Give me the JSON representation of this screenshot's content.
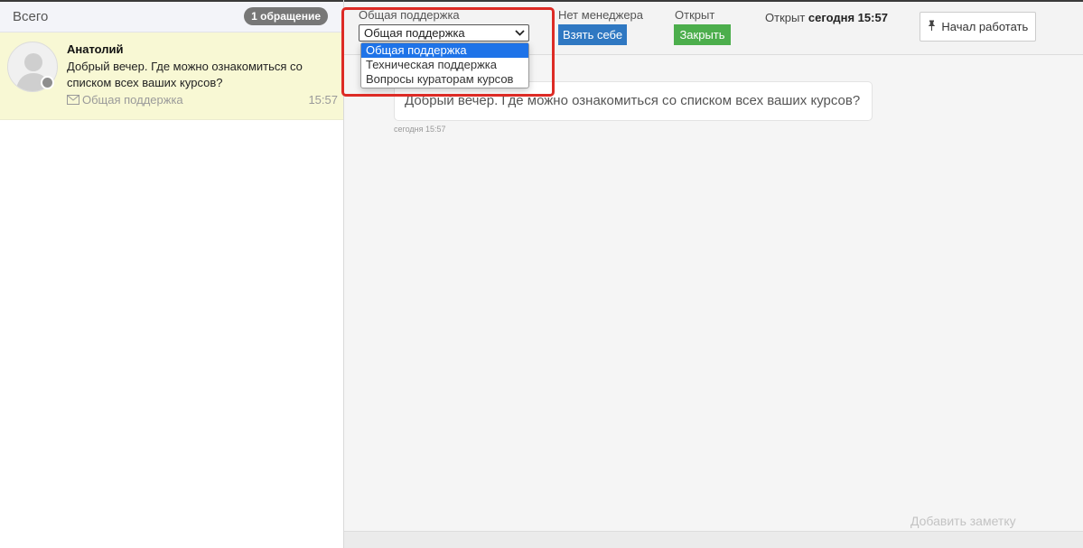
{
  "sidebar": {
    "title": "Всего",
    "count_badge": "1 обращение",
    "conversation": {
      "name": "Анатолий",
      "message": "Добрый вечер. Где можно ознакомиться со списком всех ваших курсов?",
      "department": "Общая поддержка",
      "time": "15:57"
    }
  },
  "toolbar": {
    "department_label": "Общая поддержка",
    "department_selected": "Общая поддержка",
    "department_options": [
      "Общая поддержка",
      "Техническая поддержка",
      "Вопросы кураторам курсов"
    ],
    "manager_label": "Нет менеджера",
    "take_button": "Взять себе",
    "status_label": "Открыт",
    "close_button": "Закрыть",
    "opened_prefix": "Открыт",
    "opened_time": "сегодня 15:57",
    "start_button": "Начал работать"
  },
  "chat": {
    "message": "Добрый вечер. Где можно ознакомиться со списком всех ваших курсов?",
    "time": "сегодня 15:57",
    "add_note": "Добавить заметку"
  },
  "colors": {
    "selected_item_bg": "#f8f8d4",
    "take_button_bg": "#2f78c2",
    "close_button_bg": "#4cae4c",
    "dropdown_selected_bg": "#1e73e8",
    "highlight_border": "#dd2b25"
  },
  "icons": {
    "avatar": "user-silhouette-icon",
    "department": "envelope-icon",
    "start": "pushpin-icon",
    "select": "chevron-down-icon"
  }
}
